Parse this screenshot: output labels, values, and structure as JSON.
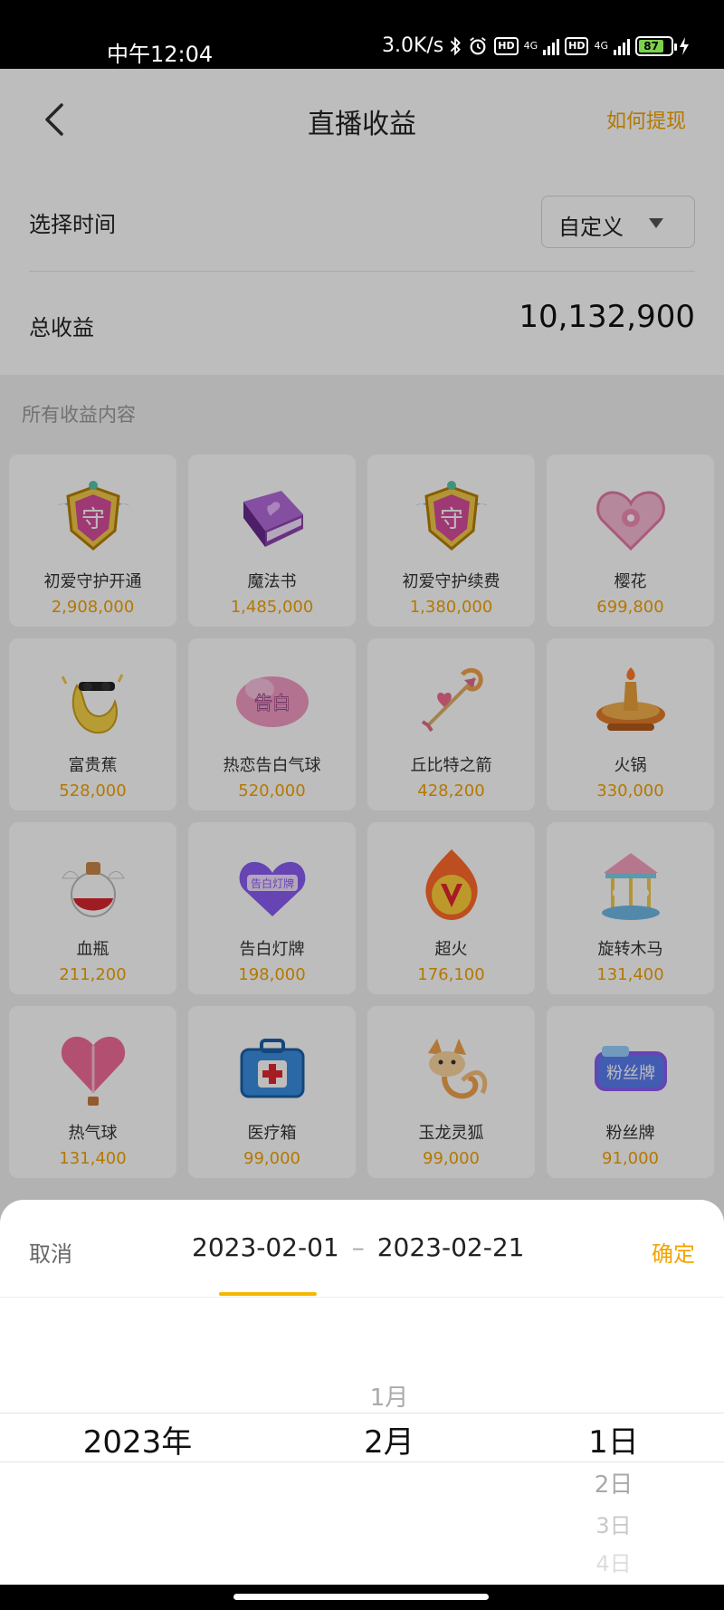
{
  "status_bar": {
    "time": "中午12:04",
    "network_speed": "3.0K/s",
    "hd_label": "HD",
    "network_type": "4G",
    "battery": "87",
    "icons": [
      "bluetooth-icon",
      "alarm-icon",
      "hd-icon",
      "signal-icon",
      "battery-icon",
      "charging-icon"
    ]
  },
  "nav": {
    "title": "直播收益",
    "right_link": "如何提现"
  },
  "filter": {
    "label": "选择时间",
    "selected": "自定义"
  },
  "total": {
    "label": "总收益",
    "value": "10,132,900"
  },
  "section_title": "所有收益内容",
  "gifts": [
    {
      "name": "初爱守护开通",
      "value": "2,908,000",
      "icon": "guard-shield-icon"
    },
    {
      "name": "魔法书",
      "value": "1,485,000",
      "icon": "magic-book-icon"
    },
    {
      "name": "初爱守护续费",
      "value": "1,380,000",
      "icon": "guard-shield-icon"
    },
    {
      "name": "樱花",
      "value": "699,800",
      "icon": "sakura-heart-box-icon"
    },
    {
      "name": "富贵蕉",
      "value": "528,000",
      "icon": "banana-icon"
    },
    {
      "name": "热恋告白气球",
      "value": "520,000",
      "icon": "confession-balloon-icon"
    },
    {
      "name": "丘比特之箭",
      "value": "428,200",
      "icon": "cupid-arrow-icon"
    },
    {
      "name": "火锅",
      "value": "330,000",
      "icon": "hotpot-icon"
    },
    {
      "name": "血瓶",
      "value": "211,200",
      "icon": "potion-icon"
    },
    {
      "name": "告白灯牌",
      "value": "198,000",
      "icon": "light-sign-icon"
    },
    {
      "name": "超火",
      "value": "176,100",
      "icon": "super-fire-icon"
    },
    {
      "name": "旋转木马",
      "value": "131,400",
      "icon": "carousel-icon"
    },
    {
      "name": "热气球",
      "value": "131,400",
      "icon": "hot-air-balloon-icon"
    },
    {
      "name": "医疗箱",
      "value": "99,000",
      "icon": "medical-kit-icon"
    },
    {
      "name": "玉龙灵狐",
      "value": "99,000",
      "icon": "fox-icon"
    },
    {
      "name": "粉丝牌",
      "value": "91,000",
      "icon": "fan-badge-icon"
    }
  ],
  "picker": {
    "cancel": "取消",
    "confirm": "确定",
    "start_date": "2023-02-01",
    "separator": "–",
    "end_date": "2023-02-21",
    "year": {
      "selected": "2023年"
    },
    "month": {
      "above": "1月",
      "selected": "2月"
    },
    "day": {
      "selected": "1日",
      "below1": "2日",
      "below2": "3日",
      "below3": "4日"
    }
  },
  "colors": {
    "accent": "#f5a300",
    "underline": "#f5b800",
    "background": "#f0f0f0"
  }
}
